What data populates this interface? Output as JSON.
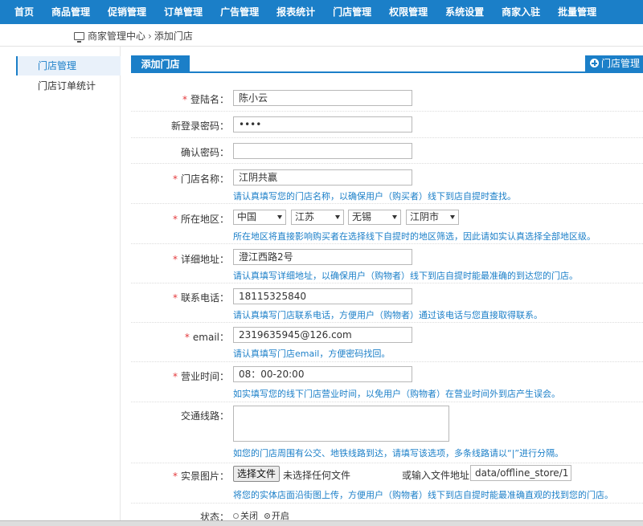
{
  "topnav": [
    "首页",
    "商品管理",
    "促销管理",
    "订单管理",
    "广告管理",
    "报表统计",
    "门店管理",
    "权限管理",
    "系统设置",
    "商家入驻",
    "批量管理"
  ],
  "breadcrumb": {
    "home": "商家管理中心",
    "sep": "›",
    "current": "添加门店"
  },
  "sidebar": [
    {
      "label": "门店管理",
      "active": true
    },
    {
      "label": "门店订单统计",
      "active": false
    }
  ],
  "tab": {
    "label": "添加门店"
  },
  "add_button": {
    "label": "门店管理"
  },
  "form": {
    "login_name": {
      "label": "登陆名：",
      "value": "陈小云"
    },
    "new_password": {
      "label": "新登录密码：",
      "value": "••••"
    },
    "confirm_password": {
      "label": "确认密码：",
      "value": ""
    },
    "store_name": {
      "label": "门店名称：",
      "value": "江阴共赢",
      "hint": "请认真填写您的门店名称，以确保用户（购买者）线下到店自提时查找。"
    },
    "region": {
      "label": "所在地区：",
      "country": "中国",
      "province": "江苏",
      "city": "无锡",
      "district": "江阴市",
      "hint": "所在地区将直接影响购买者在选择线下自提时的地区筛选，因此请如实认真选择全部地区级。"
    },
    "address": {
      "label": "详细地址：",
      "value": "澄江西路2号",
      "hint": "请认真填写详细地址，以确保用户（购物者）线下到店自提时能最准确的到达您的门店。"
    },
    "phone": {
      "label": "联系电话：",
      "value": "18115325840",
      "hint": "请认真填写门店联系电话，方便用户（购物者）通过该电话与您直接取得联系。"
    },
    "email": {
      "label": "email：",
      "value": "2319635945@126.com",
      "hint": "请认真填写门店email，方便密码找回。"
    },
    "hours": {
      "label": "营业时间：",
      "value": "08：00-20:00",
      "hint": "如实填写您的线下门店营业时间，以免用户（购物者）在营业时间外到店产生误会。"
    },
    "route": {
      "label": "交通线路：",
      "value": "",
      "hint": "如您的门店周围有公交、地铁线路到达，请填写该选项，多条线路请以“|”进行分隔。"
    },
    "photo": {
      "label": "实景图片：",
      "button": "选择文件",
      "status": "未选择任何文件",
      "url_label": "或输入文件地址",
      "url_value": "data/offline_store/1",
      "hint": "将您的实体店面沿街图上传，方便用户（购物者）线下到店自提时能最准确直观的找到您的门店。"
    },
    "state": {
      "label": "状态：",
      "options": [
        "关闭",
        "开启"
      ],
      "selected": "开启"
    }
  }
}
